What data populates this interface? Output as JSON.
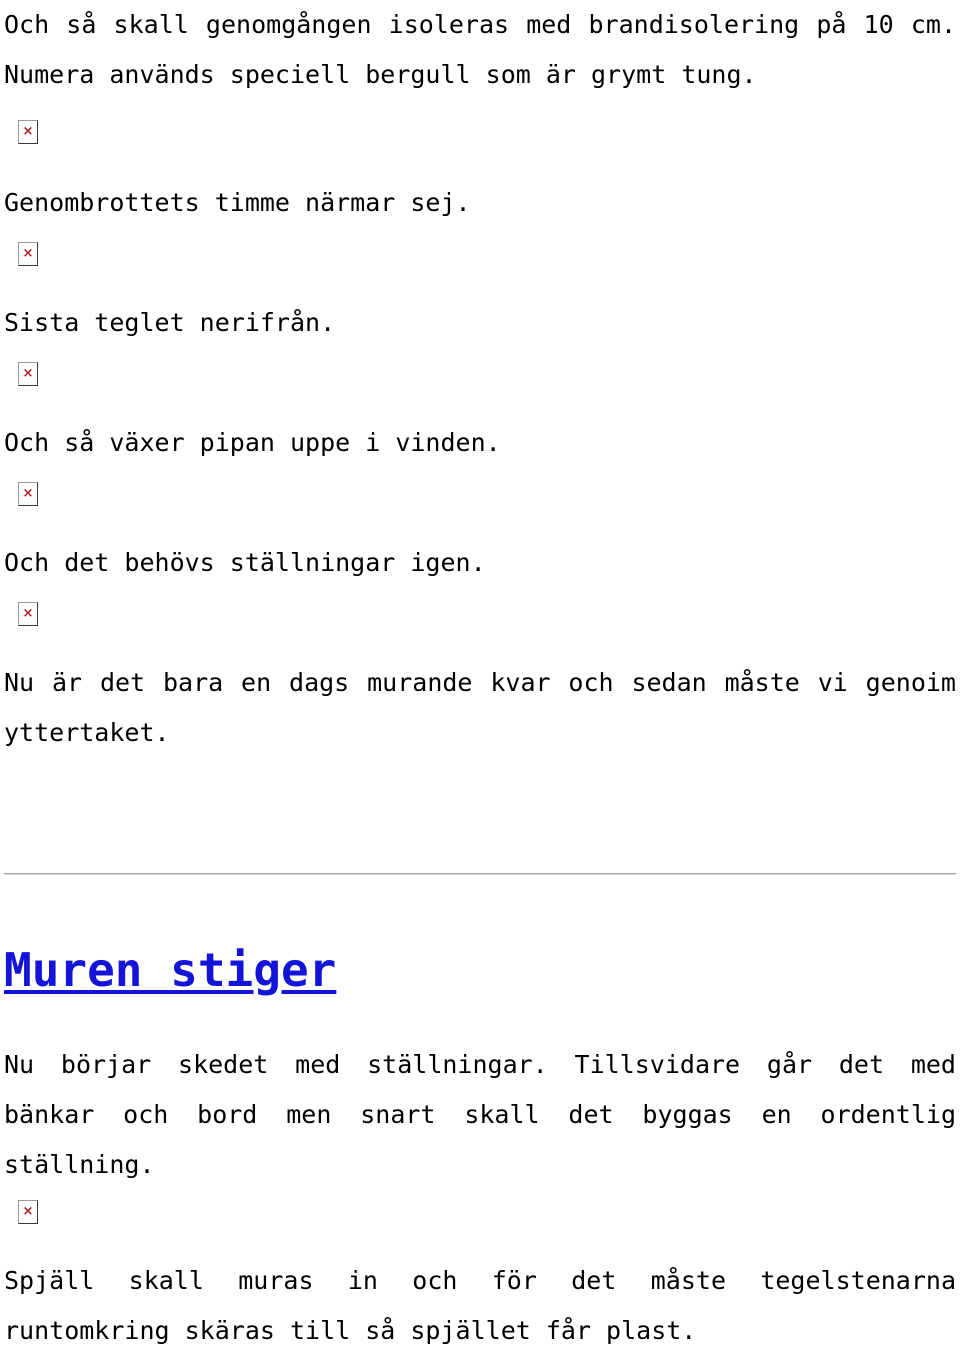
{
  "document": {
    "background_color": "#ffffff",
    "text_color": "#000000",
    "link_color": "#1414d8",
    "rule_color": "#a8a8a8"
  },
  "icons": {
    "broken_image_glyph": "×",
    "broken_image_name": "broken-image-icon"
  },
  "entries": [
    {
      "paragraph": "Och så skall genomgången isoleras med brandisolering på 10 cm. Numera används speciell bergull som är grymt tung."
    },
    {
      "paragraph": "Genombrottets timme närmar sej."
    },
    {
      "paragraph": "Sista teglet nerifrån."
    },
    {
      "paragraph": "Och så växer pipan uppe i vinden."
    },
    {
      "paragraph": "Och det behövs ställningar igen."
    },
    {
      "paragraph": "Nu är det bara en dags murande kvar och sedan måste vi genoim yttertaket."
    }
  ],
  "next_post": {
    "title": "Muren stiger",
    "paragraph_1": "Nu börjar skedet med ställningar. Tillsvidare går det med bänkar och bord men snart skall det byggas en ordentlig ställning.",
    "paragraph_2": "Spjäll skall muras in och för det måste tegelstenarna runtomkring skäras till så spjället får plast."
  }
}
